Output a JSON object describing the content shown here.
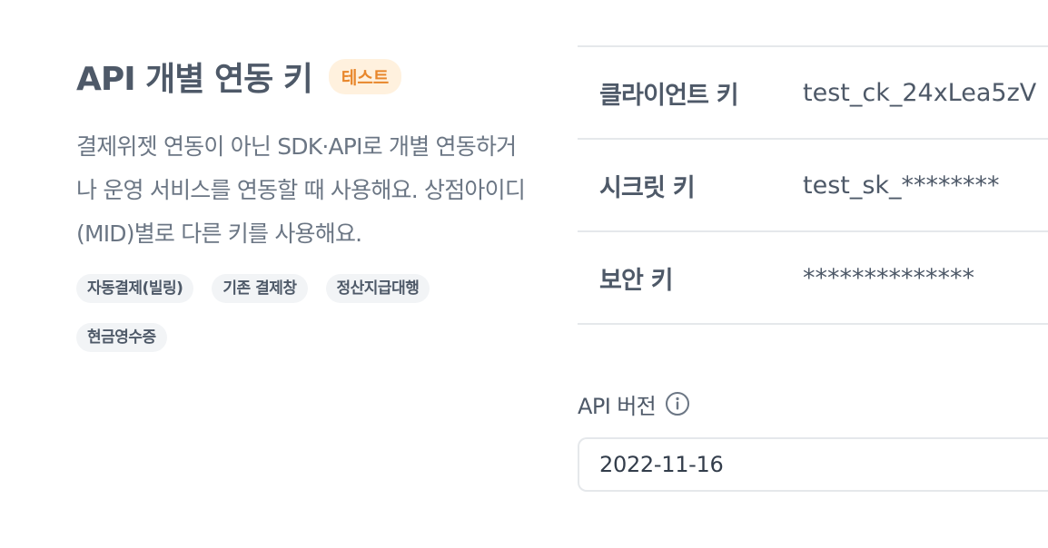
{
  "section": {
    "title": "API 개별 연동 키",
    "badge": "테스트",
    "description": "결제위젯 연동이 아닌 SDK·API로 개별 연동하거나 운영 서비스를 연동할 때 사용해요. 상점아이디(MID)별로 다른 키를 사용해요.",
    "tags": [
      "자동결제(빌링)",
      "기존 결제창",
      "정산지급대행",
      "현금영수증"
    ]
  },
  "keys": [
    {
      "label": "클라이언트 키",
      "value": "test_ck_24xLea5zV"
    },
    {
      "label": "시크릿 키",
      "value": "test_sk_********"
    },
    {
      "label": "보안 키",
      "value": "**************"
    }
  ],
  "api_version": {
    "label": "API 버전",
    "icon": "info-icon",
    "value": "2022-11-16"
  },
  "colors": {
    "text": "#4e5968",
    "badge_bg": "#fff1de",
    "badge_text": "#e8872c",
    "tag_bg": "#f2f4f6",
    "divider": "#e5e8eb"
  }
}
